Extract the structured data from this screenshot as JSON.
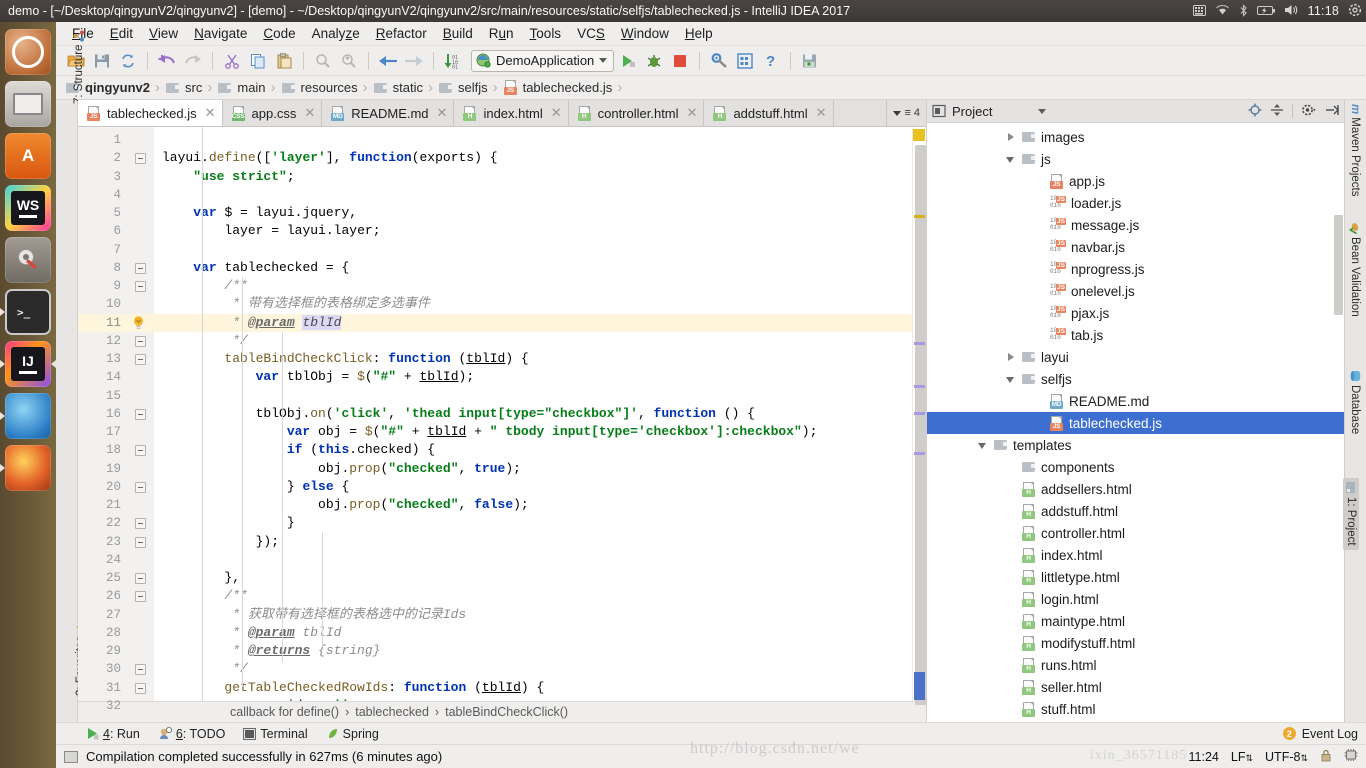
{
  "window": {
    "ubuntu_title": "demo - [~/Desktop/qingyunV2/qingyunv2] - [demo] - ~/Desktop/qingyunV2/qingyunv2/src/main/resources/static/selfjs/tablechecked.js - IntelliJ IDEA 2017",
    "clock": "11:18"
  },
  "menubar": {
    "items": [
      {
        "label": "File",
        "mnemonic": "F"
      },
      {
        "label": "Edit",
        "mnemonic": "E"
      },
      {
        "label": "View",
        "mnemonic": "V"
      },
      {
        "label": "Navigate",
        "mnemonic": "N"
      },
      {
        "label": "Code",
        "mnemonic": "C"
      },
      {
        "label": "Analyze",
        "mnemonic": "z"
      },
      {
        "label": "Refactor",
        "mnemonic": "R"
      },
      {
        "label": "Build",
        "mnemonic": "B"
      },
      {
        "label": "Run",
        "mnemonic": "u"
      },
      {
        "label": "Tools",
        "mnemonic": "T"
      },
      {
        "label": "VCS",
        "mnemonic": "S"
      },
      {
        "label": "Window",
        "mnemonic": "W"
      },
      {
        "label": "Help",
        "mnemonic": "H"
      }
    ]
  },
  "toolbar": {
    "run_configuration": "DemoApplication"
  },
  "pathbar": {
    "crumbs": [
      "qingyunv2",
      "src",
      "main",
      "resources",
      "static",
      "selfjs",
      "tablechecked.js"
    ]
  },
  "editor_tabs": {
    "tabs": [
      {
        "label": "tablechecked.js",
        "type": "js",
        "active": true
      },
      {
        "label": "app.css",
        "type": "css",
        "active": false
      },
      {
        "label": "README.md",
        "type": "md",
        "active": false
      },
      {
        "label": "index.html",
        "type": "html",
        "active": false
      },
      {
        "label": "controller.html",
        "type": "html",
        "active": false
      },
      {
        "label": "addstuff.html",
        "type": "html",
        "active": false
      }
    ],
    "overflow_count": "4"
  },
  "editor": {
    "first_line": 1,
    "last_line": 32,
    "current_line": 11,
    "lines": [
      {
        "n": 1,
        "text": ""
      },
      {
        "n": 2,
        "text": "layui.define(['layer'], function(exports) {"
      },
      {
        "n": 3,
        "text": "    \"use strict\";"
      },
      {
        "n": 4,
        "text": ""
      },
      {
        "n": 5,
        "text": "    var $ = layui.jquery,"
      },
      {
        "n": 6,
        "text": "        layer = layui.layer;"
      },
      {
        "n": 7,
        "text": ""
      },
      {
        "n": 8,
        "text": "    var tablechecked = {"
      },
      {
        "n": 9,
        "text": "        /**"
      },
      {
        "n": 10,
        "text": "         * 带有选择框的表格绑定多选事件"
      },
      {
        "n": 11,
        "text": "         * @param tblId"
      },
      {
        "n": 12,
        "text": "         */"
      },
      {
        "n": 13,
        "text": "        tableBindCheckClick: function (tblId) {"
      },
      {
        "n": 14,
        "text": "            var tblObj = $(\"#\" + tblId);"
      },
      {
        "n": 15,
        "text": ""
      },
      {
        "n": 16,
        "text": "            tblObj.on('click', 'thead input[type=\"checkbox\"]', function () {"
      },
      {
        "n": 17,
        "text": "                var obj = $(\"#\" + tblId + \" tbody input[type='checkbox']:checkbox\");"
      },
      {
        "n": 18,
        "text": "                if (this.checked) {"
      },
      {
        "n": 19,
        "text": "                    obj.prop(\"checked\", true);"
      },
      {
        "n": 20,
        "text": "                } else {"
      },
      {
        "n": 21,
        "text": "                    obj.prop(\"checked\", false);"
      },
      {
        "n": 22,
        "text": "                }"
      },
      {
        "n": 23,
        "text": "            });"
      },
      {
        "n": 24,
        "text": ""
      },
      {
        "n": 25,
        "text": "        },"
      },
      {
        "n": 26,
        "text": "        /**"
      },
      {
        "n": 27,
        "text": "         * 获取带有选择框的表格选中的记录Ids"
      },
      {
        "n": 28,
        "text": "         * @param tblId"
      },
      {
        "n": 29,
        "text": "         * @returns {string}"
      },
      {
        "n": 30,
        "text": "         */"
      },
      {
        "n": 31,
        "text": "        getTableCheckedRowIds: function (tblId) {"
      },
      {
        "n": 32,
        "text": "            var ids = '';"
      }
    ]
  },
  "editor_breadcrumb": {
    "items": [
      "callback for define()",
      "tablechecked",
      "tableBindCheckClick()"
    ]
  },
  "left_strips": {
    "top": "7: Structure",
    "bottom": "2: Favorites"
  },
  "right_strips": {
    "items": [
      "Maven Projects",
      "Bean Validation",
      "Database",
      "1: Project"
    ],
    "active": "1: Project"
  },
  "project_panel": {
    "title": "Project",
    "tree": [
      {
        "label": "images",
        "indent": 2,
        "kind": "folder",
        "arrow": "closed",
        "selected": false
      },
      {
        "label": "js",
        "indent": 2,
        "kind": "folder",
        "arrow": "open",
        "selected": false
      },
      {
        "label": "app.js",
        "indent": 3,
        "kind": "js",
        "arrow": "none",
        "selected": false
      },
      {
        "label": "loader.js",
        "indent": 3,
        "kind": "jsbin",
        "arrow": "none",
        "selected": false
      },
      {
        "label": "message.js",
        "indent": 3,
        "kind": "jsbin",
        "arrow": "none",
        "selected": false
      },
      {
        "label": "navbar.js",
        "indent": 3,
        "kind": "jsbin",
        "arrow": "none",
        "selected": false
      },
      {
        "label": "nprogress.js",
        "indent": 3,
        "kind": "jsbin",
        "arrow": "none",
        "selected": false
      },
      {
        "label": "onelevel.js",
        "indent": 3,
        "kind": "jsbin",
        "arrow": "none",
        "selected": false
      },
      {
        "label": "pjax.js",
        "indent": 3,
        "kind": "jsbin",
        "arrow": "none",
        "selected": false
      },
      {
        "label": "tab.js",
        "indent": 3,
        "kind": "jsbin",
        "arrow": "none",
        "selected": false
      },
      {
        "label": "layui",
        "indent": 2,
        "kind": "folder",
        "arrow": "closed",
        "selected": false
      },
      {
        "label": "selfjs",
        "indent": 2,
        "kind": "folder",
        "arrow": "open",
        "selected": false
      },
      {
        "label": "README.md",
        "indent": 3,
        "kind": "md",
        "arrow": "none",
        "selected": false
      },
      {
        "label": "tablechecked.js",
        "indent": 3,
        "kind": "js",
        "arrow": "none",
        "selected": true
      },
      {
        "label": "templates",
        "indent": 1,
        "kind": "folder",
        "arrow": "open",
        "selected": false
      },
      {
        "label": "components",
        "indent": 2,
        "kind": "folder",
        "arrow": "none",
        "selected": false
      },
      {
        "label": "addsellers.html",
        "indent": 2,
        "kind": "html",
        "arrow": "none",
        "selected": false
      },
      {
        "label": "addstuff.html",
        "indent": 2,
        "kind": "html",
        "arrow": "none",
        "selected": false
      },
      {
        "label": "controller.html",
        "indent": 2,
        "kind": "html",
        "arrow": "none",
        "selected": false
      },
      {
        "label": "index.html",
        "indent": 2,
        "kind": "html",
        "arrow": "none",
        "selected": false
      },
      {
        "label": "littletype.html",
        "indent": 2,
        "kind": "html",
        "arrow": "none",
        "selected": false
      },
      {
        "label": "login.html",
        "indent": 2,
        "kind": "html",
        "arrow": "none",
        "selected": false
      },
      {
        "label": "maintype.html",
        "indent": 2,
        "kind": "html",
        "arrow": "none",
        "selected": false
      },
      {
        "label": "modifystuff.html",
        "indent": 2,
        "kind": "html",
        "arrow": "none",
        "selected": false
      },
      {
        "label": "runs.html",
        "indent": 2,
        "kind": "html",
        "arrow": "none",
        "selected": false
      },
      {
        "label": "seller.html",
        "indent": 2,
        "kind": "html",
        "arrow": "none",
        "selected": false
      },
      {
        "label": "stuff.html",
        "indent": 2,
        "kind": "html",
        "arrow": "none",
        "selected": false
      }
    ]
  },
  "bottom_toolwindows": {
    "items": [
      {
        "label": "4: Run",
        "mnemonic": "4",
        "icon": "run-icon"
      },
      {
        "label": "6: TODO",
        "mnemonic": "6",
        "icon": "todo-icon"
      },
      {
        "label": "Terminal",
        "mnemonic": "",
        "icon": "terminal-icon"
      },
      {
        "label": "Spring",
        "mnemonic": "",
        "icon": "spring-icon"
      }
    ],
    "event_log": "Event Log",
    "event_log_count": "2"
  },
  "statusbar": {
    "message": "Compilation completed successfully in 627ms (6 minutes ago)",
    "time": "11:24",
    "line_separator": "LF",
    "encoding": "UTF-8"
  },
  "watermark": {
    "text": "http://blog.csdn.net/we",
    "text2": "ixin_36571185"
  },
  "colors": {
    "selection": "#3d6fd0",
    "current_line": "#fdf6dd",
    "keyword": "#0033b3",
    "string": "#067d17",
    "comment": "#8c8c8c",
    "accent_orange": "#f0a930"
  }
}
